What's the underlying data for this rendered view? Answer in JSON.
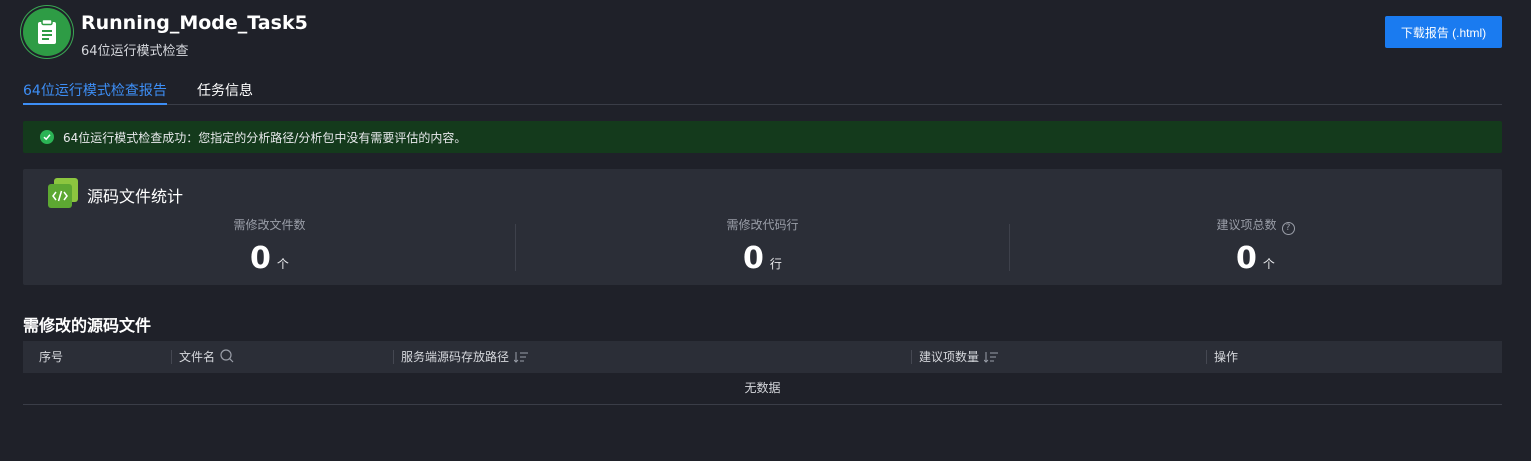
{
  "header": {
    "title": "Running_Mode_Task5",
    "subtitle": "64位运行模式检查",
    "download_label": "下载报告 (.html)"
  },
  "tabs": [
    {
      "label": "64位运行模式检查报告",
      "active": true
    },
    {
      "label": "任务信息",
      "active": false
    }
  ],
  "alert": {
    "text": "64位运行模式检查成功：您指定的分析路径/分析包中没有需要评估的内容。",
    "icon": "check-circle-icon"
  },
  "stats": {
    "title": "源码文件统计",
    "items": [
      {
        "label": "需修改文件数",
        "value": "0",
        "unit": "个"
      },
      {
        "label": "需修改代码行",
        "value": "0",
        "unit": "行"
      },
      {
        "label": "建议项总数",
        "value": "0",
        "unit": "个",
        "help": "?"
      }
    ]
  },
  "files_section": {
    "title": "需修改的源码文件",
    "columns": [
      {
        "label": "序号"
      },
      {
        "label": "文件名",
        "icon": "search-icon"
      },
      {
        "label": "服务端源码存放路径",
        "icon": "sort-icon"
      },
      {
        "label": "建议项数量",
        "icon": "sort-icon"
      },
      {
        "label": "操作"
      }
    ],
    "empty_text": "无数据",
    "rows": []
  },
  "colors": {
    "accent": "#1a7bf0",
    "background": "#1f2129",
    "panel": "#2b2e37",
    "success": "#2bb455"
  }
}
